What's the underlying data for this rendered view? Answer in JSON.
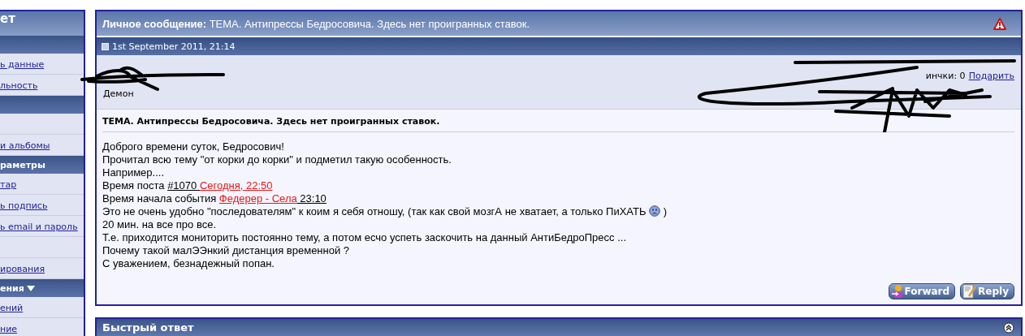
{
  "sidebar": {
    "items": [
      {
        "kind": "title",
        "text": "ет"
      },
      {
        "kind": "band"
      },
      {
        "kind": "link",
        "text": "ь данные"
      },
      {
        "kind": "link",
        "text": "льность"
      },
      {
        "kind": "band"
      },
      {
        "kind": "empty"
      },
      {
        "kind": "link",
        "text": "и альбомы"
      },
      {
        "kind": "header",
        "text": "раметры"
      },
      {
        "kind": "link",
        "text": "тар"
      },
      {
        "kind": "link",
        "text": "ь подпись"
      },
      {
        "kind": "link",
        "text": "ь email и пароль"
      },
      {
        "kind": "empty"
      },
      {
        "kind": "link",
        "text": "ирования"
      },
      {
        "kind": "header",
        "text": "ения",
        "caret": true
      },
      {
        "kind": "link",
        "text": "ений"
      },
      {
        "kind": "link",
        "text": "ние"
      }
    ]
  },
  "message": {
    "title_label": "Личное сообщение:",
    "title": "ТЕМА. Антипрессы Бедросовича. Здесь нет проигранных ставок.",
    "date": "1st September 2011, 21:14",
    "user_title": "Демон",
    "user_info": {
      "text": "инчки: 0",
      "link": "Подарить"
    },
    "subject": "ТЕМА. Антипрессы Бедросовича. Здесь нет проигранных ставок.",
    "lines": [
      [
        {
          "kind": "text",
          "text": "Доброго времени суток, Бедросович!"
        }
      ],
      [
        {
          "kind": "text",
          "text": "Прочитал всю тему \"от корки до корки\" и подметил такую особенность."
        }
      ],
      [
        {
          "kind": "text",
          "text": "Например...."
        }
      ],
      [
        {
          "kind": "text",
          "text": "Время поста "
        },
        {
          "kind": "link",
          "text": "#1070 "
        },
        {
          "kind": "red-link",
          "text": "Сегодня, 22:50"
        }
      ],
      [
        {
          "kind": "text",
          "text": "Время начала события "
        },
        {
          "kind": "red-link",
          "text": "Федерер - Села"
        },
        {
          "kind": "link",
          "text": " 23:10"
        }
      ],
      [
        {
          "kind": "text",
          "text": "Это не очень удобно \"последователям\" к коим я себя отношу, (так как свой мозгА не хватает, а только ПиХАТЬ "
        },
        {
          "kind": "smiley"
        },
        {
          "kind": "text",
          "text": " )"
        }
      ],
      [
        {
          "kind": "text",
          "text": "20 мин. на все про все."
        }
      ],
      [
        {
          "kind": "text",
          "text": "Т.е. приходится мониторить постоянно тему, а потом есчо успеть заскочить на данный АнтиБедроПресс ..."
        }
      ],
      [
        {
          "kind": "text",
          "text": "Почему такой малЭЭнкий дистанция временной ?"
        }
      ],
      [
        {
          "kind": "text",
          "text": "С уважением, безнадежный попан."
        }
      ]
    ],
    "buttons": [
      {
        "kind": "forward",
        "label": "Forward"
      },
      {
        "kind": "reply",
        "label": "Reply"
      }
    ]
  },
  "quick_reply": {
    "title": "Быстрый ответ"
  }
}
